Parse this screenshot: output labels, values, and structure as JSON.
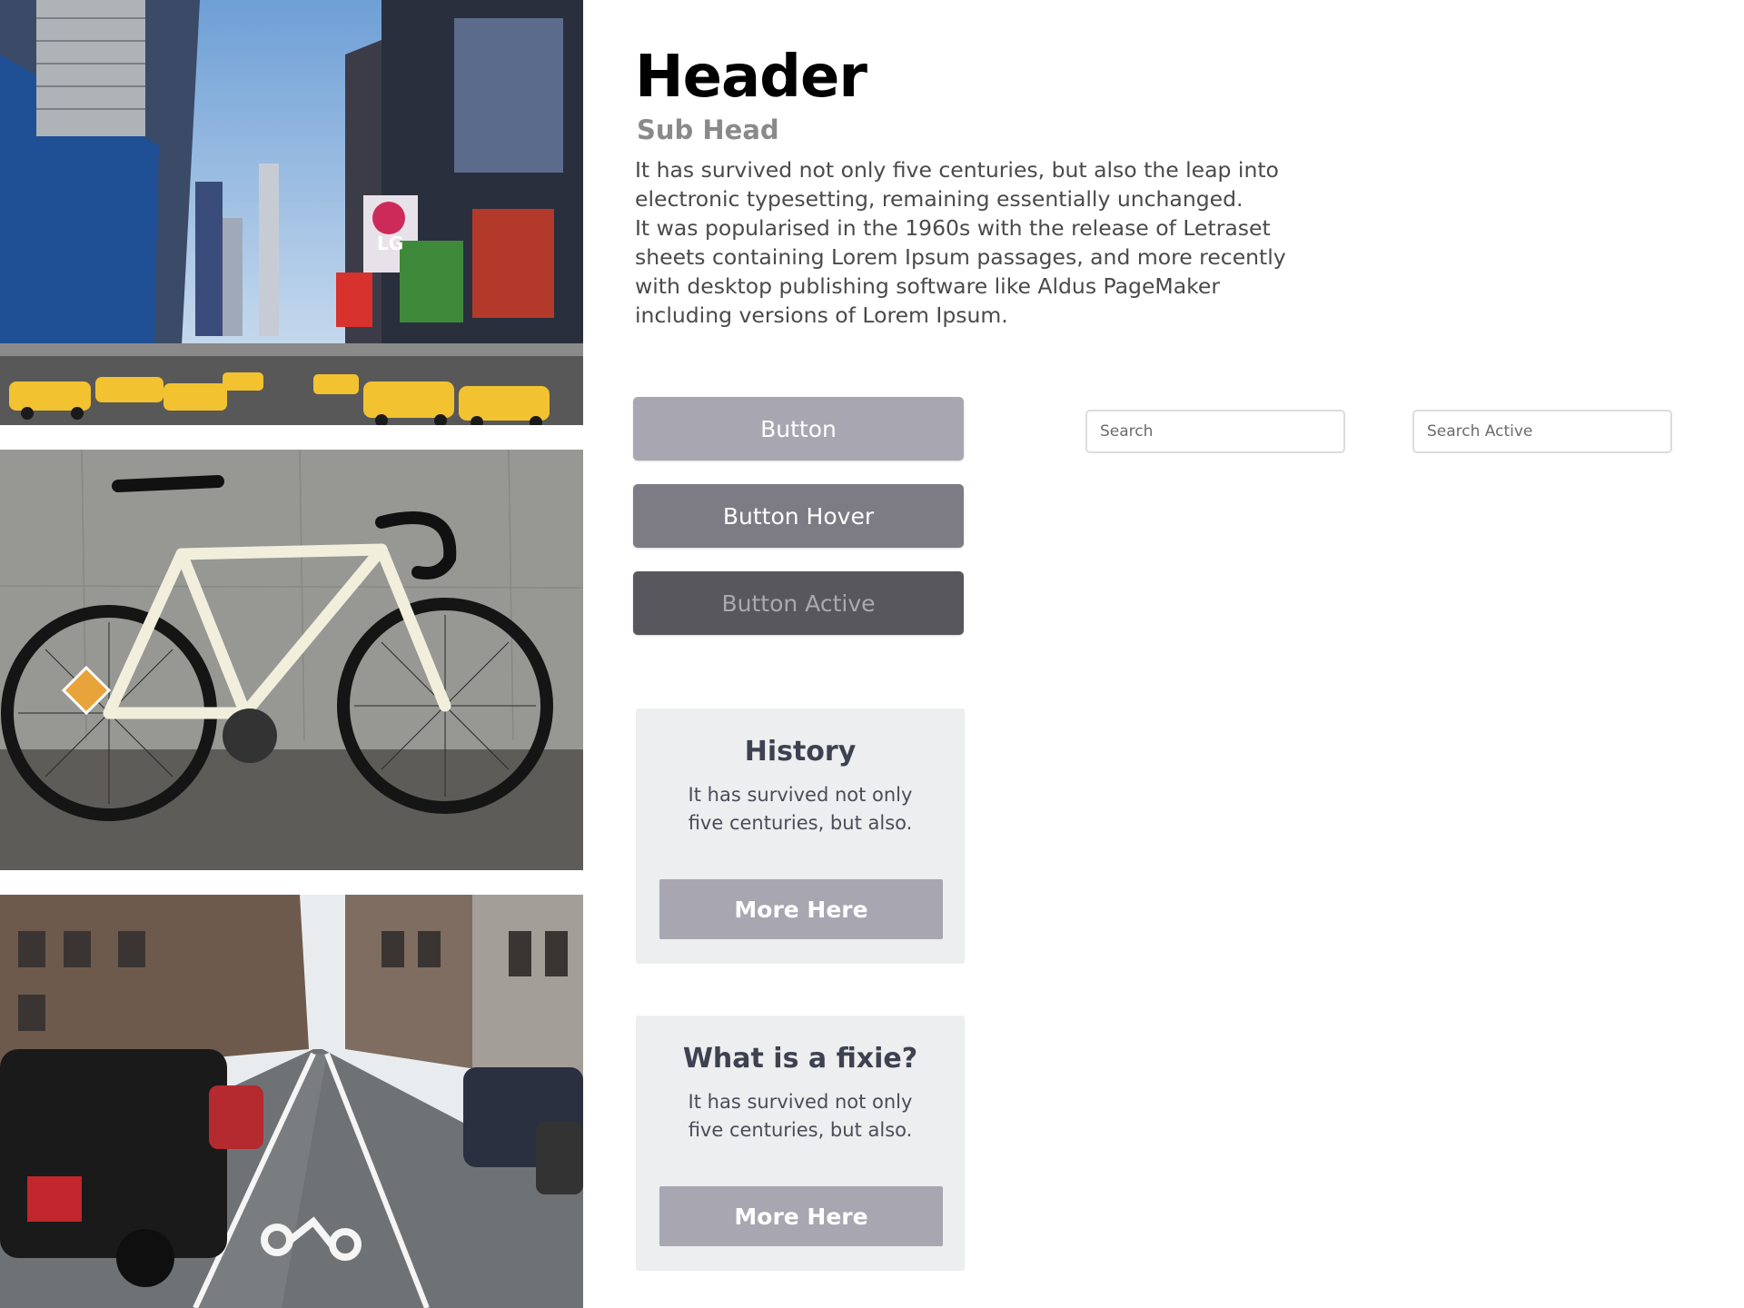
{
  "header": {
    "title": "Header",
    "subtitle": "Sub Head",
    "paragraphs": [
      "It has survived not only five centuries, but also the leap into\nelectronic typesetting, remaining essentially unchanged.",
      "It was popularised in the 1960s with the release of Letraset\nsheets containing Lorem Ipsum passages, and more recently\nwith desktop publishing software like Aldus PageMaker\nincluding versions of Lorem Ipsum."
    ]
  },
  "buttons": {
    "normal": "Button",
    "hover": "Button Hover",
    "active": "Button Active"
  },
  "search": {
    "default_placeholder": "Search",
    "active_placeholder": "Search Active"
  },
  "cards": [
    {
      "title": "History",
      "text": "It has survived not only\nfive centuries, but also.",
      "button": "More Here"
    },
    {
      "title": "What is a fixie?",
      "text": "It has survived not only\nfive centuries, but also.",
      "button": "More Here"
    }
  ],
  "photos": {
    "city_sign": "LG",
    "palette": {
      "sky": "#8fb4de",
      "taxi": "#f2c230",
      "bike_frame": "#f1efdc",
      "concrete": "#8f8f8c",
      "asphalt": "#55585c"
    }
  },
  "colors": {
    "button": "#a7a6b1",
    "button_hover": "#7d7c84",
    "button_active": "#58575e",
    "card_bg": "#eceeef",
    "title_dark": "#3d4150"
  }
}
